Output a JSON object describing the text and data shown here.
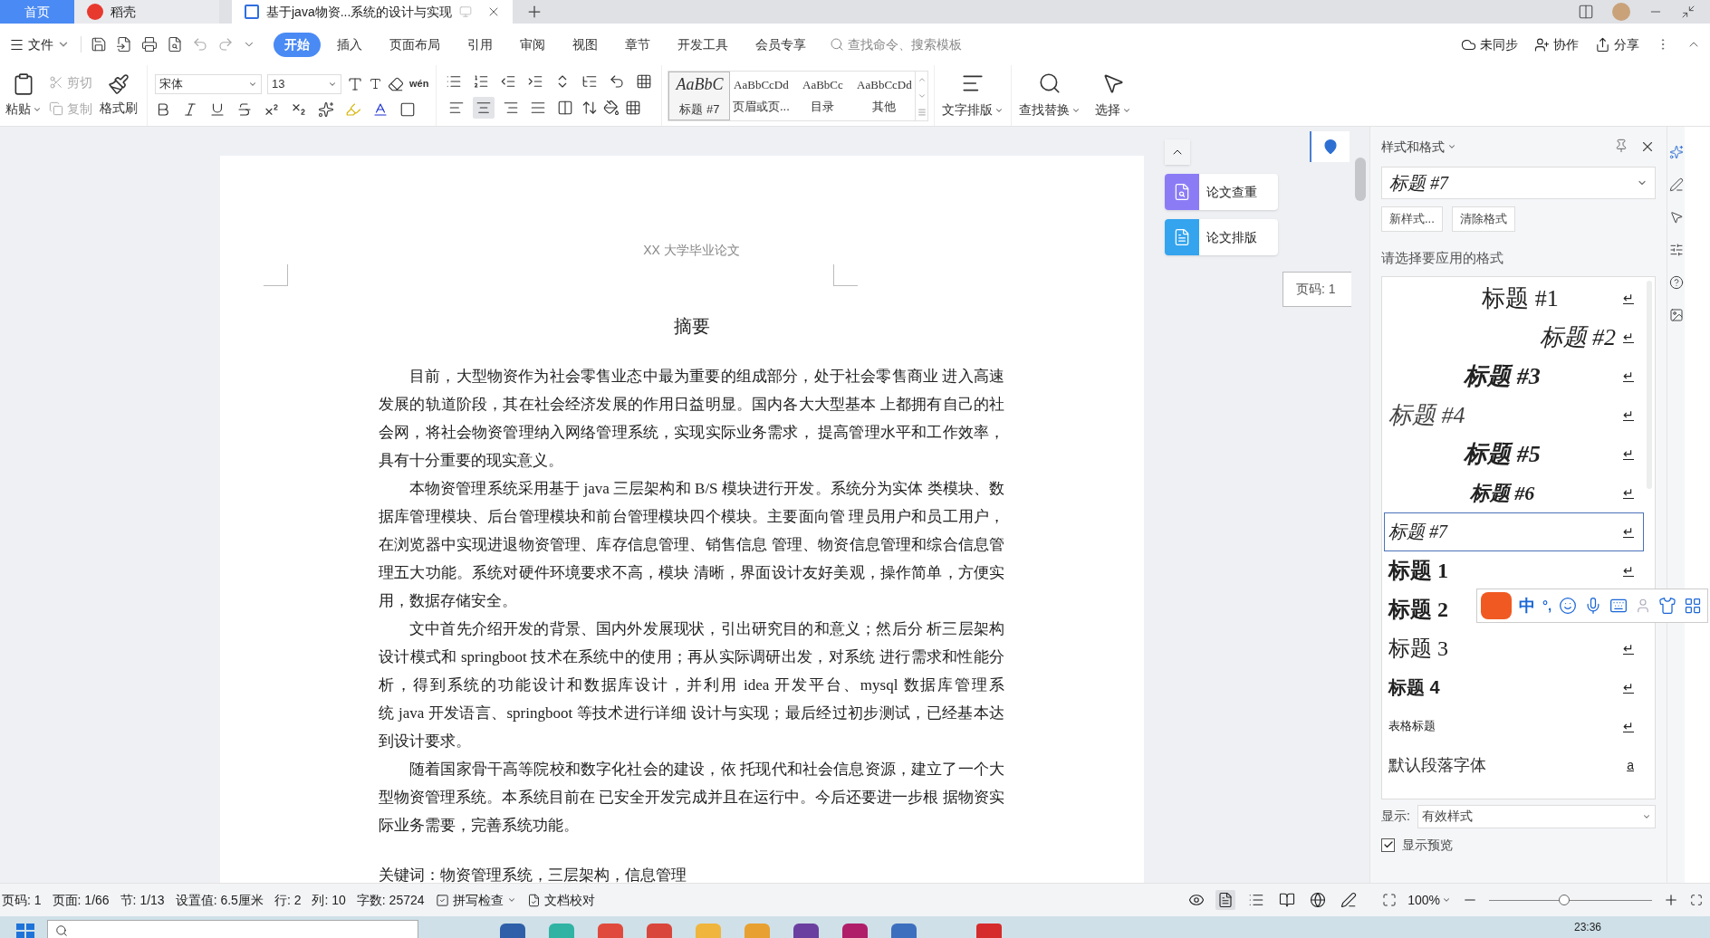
{
  "tabs": [
    {
      "kind": "home",
      "label": "首页",
      "selected": false
    },
    {
      "kind": "app",
      "label": "稻壳",
      "selected": false
    },
    {
      "kind": "document",
      "label": "基于java物资...系统的设计与实现",
      "selected": true
    }
  ],
  "menu": {
    "file": "文件",
    "tabs": [
      {
        "label": "开始",
        "selected": true
      },
      {
        "label": "插入",
        "selected": false
      },
      {
        "label": "页面布局",
        "selected": false
      },
      {
        "label": "引用",
        "selected": false
      },
      {
        "label": "审阅",
        "selected": false
      },
      {
        "label": "视图",
        "selected": false
      },
      {
        "label": "章节",
        "selected": false
      },
      {
        "label": "开发工具",
        "selected": false
      },
      {
        "label": "会员专享",
        "selected": false
      }
    ],
    "search": {
      "placeholder": "查找命令、搜索模板"
    },
    "actions": [
      "未同步",
      "协作",
      "分享"
    ]
  },
  "ribbon": {
    "paste": "粘贴",
    "cut": {
      "label": "剪切",
      "disabled": true
    },
    "copy": {
      "label": "复制",
      "disabled": true
    },
    "format_painter": "格式刷",
    "font": "宋体",
    "size": "13",
    "phonetic": "wén",
    "align": [
      {
        "selected": false
      },
      {
        "selected": true
      },
      {
        "selected": false
      },
      {
        "selected": false
      },
      {
        "selected": false
      }
    ],
    "styles": [
      {
        "preview": "AaBbC",
        "label": "标题 #7",
        "selected": true
      },
      {
        "preview": "AaBbCcDd",
        "label": "页眉或页...",
        "selected": false
      },
      {
        "preview": "AaBbCc",
        "label": "目录",
        "selected": false
      },
      {
        "preview": "AaBbCcDd",
        "label": "其他",
        "selected": false
      }
    ],
    "text_layout": "文字排版",
    "find_replace": "查找替换",
    "select": "选择"
  },
  "document": {
    "header": "XX 大学毕业论文",
    "title": "摘要",
    "paragraphs": [
      "目前，大型物资作为社会零售业态中最为重要的组成部分，处于社会零售商业 进入高速发展的轨道阶段，其在社会经济发展的作用日益明显。国内各大大型基本 上都拥有自己的社会网，将社会物资管理纳入网络管理系统，实现实际业务需求， 提高管理水平和工作效率，具有十分重要的现实意义。",
      "本物资管理系统采用基于 java 三层架构和 B/S 模块进行开发。系统分为实体 类模块、数据库管理模块、后台管理模块和前台管理模块四个模块。主要面向管 理员用户和员工用户，在浏览器中实现进退物资管理、库存信息管理、销售信息 管理、物资信息管理和综合信息管理五大功能。系统对硬件环境要求不高，模块 清晰，界面设计友好美观，操作简单，方便实用，数据存储安全。",
      "文中首先介绍开发的背景、国内外发展现状，引出研究目的和意义；然后分 析三层架构设计模式和 springboot 技术在系统中的使用；再从实际调研出发，对系统 进行需求和性能分析，得到系统的功能设计和数据库设计，并利用 idea 开发平台、mysql 数据库管理系统 java 开发语言、springboot 等技术进行详细 设计与实现；最后经过初步测试，已经基本达到设计要求。",
      "随着国家骨干高等院校和数字化社会的建设，依 托现代和社会信息资源，建立了一个大型物资管理系统。本系统目前在 已安全开发完成并且在运行中。今后还要进一步根 据物资实际业务需要，完善系统功能。"
    ],
    "keywords": "关键词：物资管理系统，三层架构，信息管理"
  },
  "float": {
    "plagiarism_check": "论文查重",
    "thesis_format": "论文排版",
    "page_tip": "页码: 1"
  },
  "panel": {
    "title": "样式和格式",
    "current": "标题 #7",
    "buttons": [
      "新样式...",
      "清除格式"
    ],
    "prompt": "请选择要应用的格式",
    "styles": [
      {
        "label": "标题 #1",
        "symbol": "↵",
        "selected": false
      },
      {
        "label": "标题 #2",
        "symbol": "↵",
        "selected": false
      },
      {
        "label": "标题 #3",
        "symbol": "↵",
        "selected": false
      },
      {
        "label": "标题 #4",
        "symbol": "↵",
        "selected": false
      },
      {
        "label": "标题 #5",
        "symbol": "↵",
        "selected": false
      },
      {
        "label": "标题 #6",
        "symbol": "↵",
        "selected": false
      },
      {
        "label": "标题 #7",
        "symbol": "↵",
        "selected": true
      },
      {
        "label": "标题 1",
        "symbol": "↵",
        "selected": false
      },
      {
        "label": "标题 2",
        "selected": false
      },
      {
        "label": "标题 3",
        "symbol": "↵",
        "selected": false
      },
      {
        "label": "标题 4",
        "symbol": "↵",
        "selected": false
      },
      {
        "label": "表格标题",
        "symbol": "↵",
        "selected": false
      },
      {
        "label": "默认段落字体",
        "symbol": "a",
        "selected": false
      }
    ],
    "show_label": "显示:",
    "show_value": "有效样式",
    "preview": {
      "label": "显示预览",
      "checked": true
    }
  },
  "ime": {
    "chinese": "中",
    "punct": "°,"
  },
  "status": {
    "items": [
      "页码: 1",
      "页面: 1/66",
      "节: 1/13",
      "设置值: 6.5厘米",
      "行: 2",
      "列: 10",
      "字数: 25724"
    ],
    "spell_check": "拼写检查",
    "proofread": "文档校对",
    "views": [
      {
        "selected": true
      },
      {
        "selected": false
      },
      {
        "selected": false
      },
      {
        "selected": false
      },
      {
        "selected": false
      }
    ],
    "zoom": "100%",
    "level": 0.46
  },
  "taskbar": {
    "time": "23:36"
  }
}
